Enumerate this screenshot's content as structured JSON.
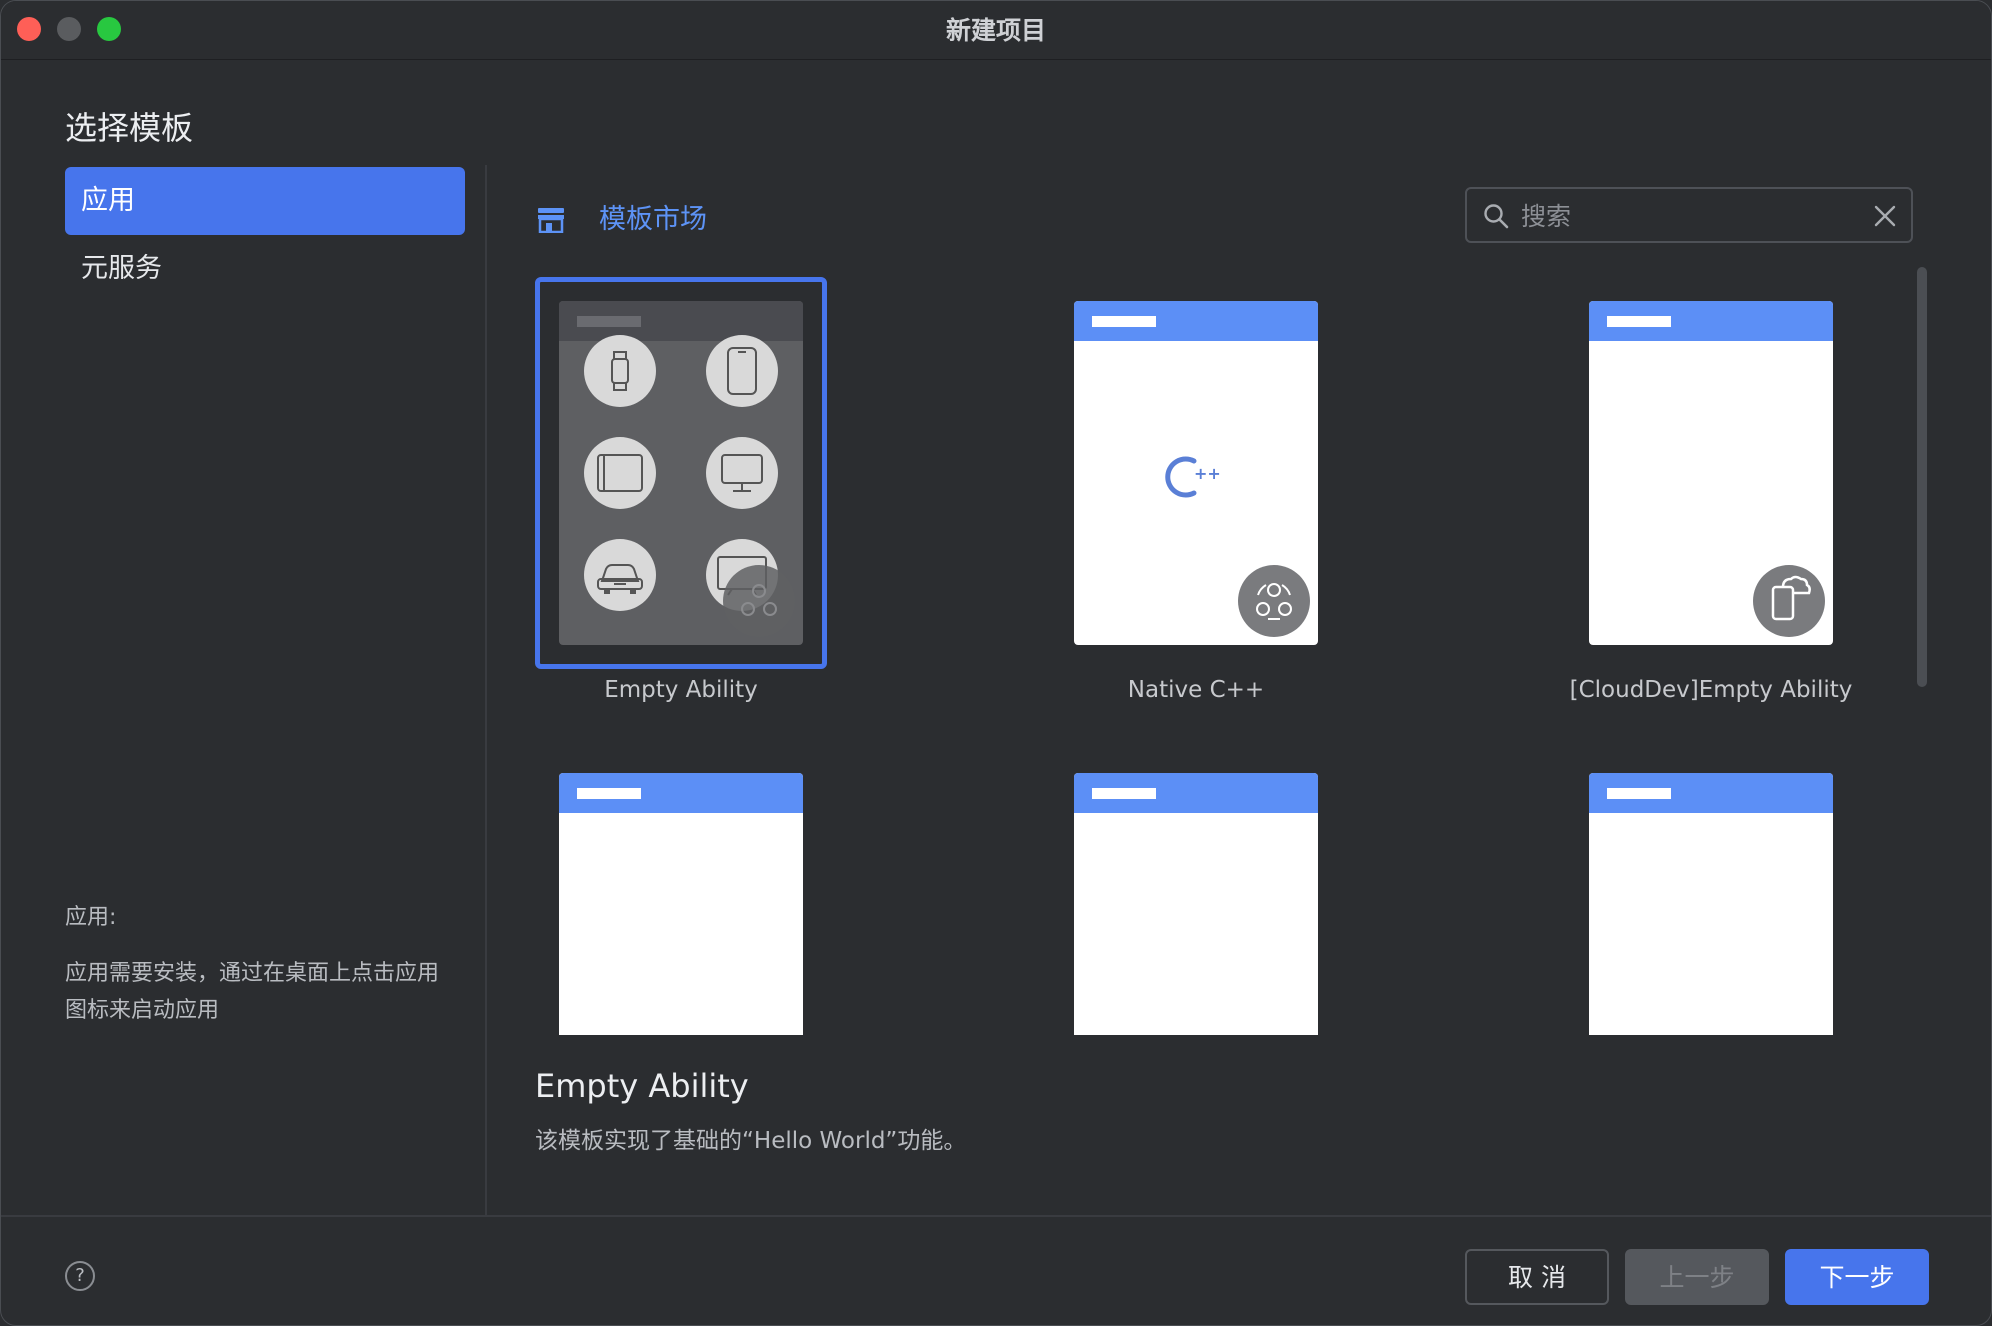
{
  "window": {
    "title": "新建项目"
  },
  "sidebar": {
    "heading": "选择模板",
    "items": [
      {
        "label": "应用",
        "active": true
      },
      {
        "label": "元服务",
        "active": false
      }
    ],
    "description_label": "应用:",
    "description_text": "应用需要安装，通过在桌面上点击应用图标来启动应用"
  },
  "market": {
    "title": "模板市场"
  },
  "search": {
    "placeholder": "搜索",
    "value": ""
  },
  "templates": [
    {
      "label": "Empty Ability",
      "selected": true,
      "icon": "multi-device-icon"
    },
    {
      "label": "Native C++",
      "selected": false,
      "icon": "cpp-icon"
    },
    {
      "label": "[CloudDev]Empty Ability",
      "selected": false,
      "icon": "cloud-phone-icon"
    },
    {
      "label": "",
      "selected": false
    },
    {
      "label": "",
      "selected": false
    },
    {
      "label": "",
      "selected": false
    }
  ],
  "detail": {
    "title": "Empty Ability",
    "description": "该模板实现了基础的“Hello World”功能。"
  },
  "footer": {
    "help": "?",
    "cancel_label": "取 消",
    "prev_label": "上一步",
    "next_label": "下一步"
  },
  "colors": {
    "accent": "#4775ec",
    "background": "#2b2d30",
    "thumb_header": "#5c8ff6"
  }
}
